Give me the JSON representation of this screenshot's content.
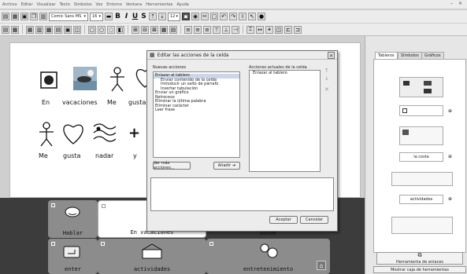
{
  "menu": [
    "Archivo",
    "Editar",
    "Visualizar",
    "Texto",
    "Símbolos",
    "Voz",
    "Entorno",
    "Ventana",
    "Herramientas",
    "Ayuda"
  ],
  "toolbar": {
    "font_name": "Comic Sans MS",
    "font_size": "16",
    "size_small": "12"
  },
  "document": {
    "row1": [
      "En",
      "vacaciones",
      "Me",
      "gusta"
    ],
    "row2": [
      "Me",
      "gusta",
      "nadar",
      "y"
    ],
    "plus": "+"
  },
  "right_panel": {
    "tabs": [
      "Tableros",
      "Símbolos",
      "Gráficos"
    ],
    "cell_label_1": "la costa",
    "cell_label_2": "actividades",
    "button_enlaces": "Herramienta de enlaces",
    "button_mostrar": "Mostrar caja de herramientas"
  },
  "grid": {
    "cells": [
      {
        "label": "Hablar"
      },
      {
        "label": "En vacaciones"
      },
      {
        "label": "Donde"
      },
      {
        "label": "enter"
      },
      {
        "label": "actividades"
      },
      {
        "label": "entretenimiento"
      }
    ]
  },
  "dialog": {
    "title": "Editar las acciones de la celda",
    "available_label": "Nuevas acciones",
    "current_label": "Acciones actuales de la celda",
    "available": [
      "Enlazar al tablero",
      "Enviar contenido de la celda",
      "Introducir un salto de párrafo",
      "Insertar tabulación",
      "Enviar un gráfico",
      "Retroceso",
      "Eliminar la última palabra",
      "Eliminar carácter",
      "Leer frase"
    ],
    "current": [
      "Enlazar al tablero"
    ],
    "more_button": "Ver más acciones...",
    "add_button": "Añadir",
    "accept_button": "Aceptar",
    "cancel_button": "Cancelar"
  }
}
